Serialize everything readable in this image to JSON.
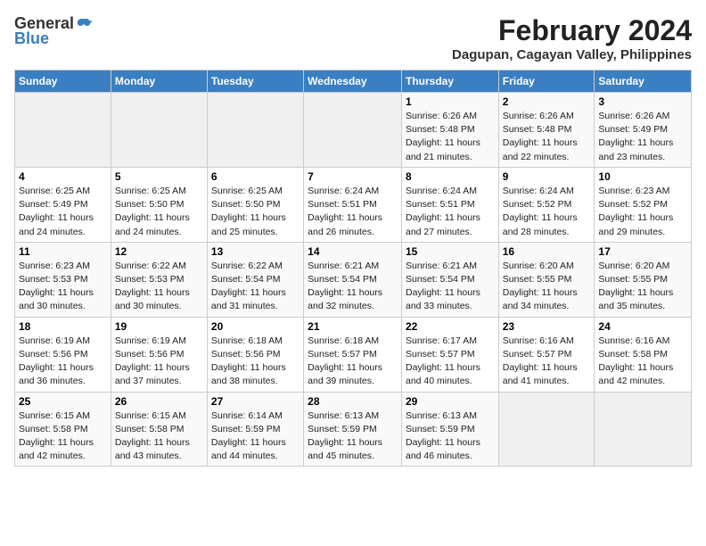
{
  "header": {
    "logo_general": "General",
    "logo_blue": "Blue",
    "month_year": "February 2024",
    "location": "Dagupan, Cagayan Valley, Philippines"
  },
  "days_of_week": [
    "Sunday",
    "Monday",
    "Tuesday",
    "Wednesday",
    "Thursday",
    "Friday",
    "Saturday"
  ],
  "weeks": [
    [
      {
        "day": "",
        "info": ""
      },
      {
        "day": "",
        "info": ""
      },
      {
        "day": "",
        "info": ""
      },
      {
        "day": "",
        "info": ""
      },
      {
        "day": "1",
        "info": "Sunrise: 6:26 AM\nSunset: 5:48 PM\nDaylight: 11 hours and 21 minutes."
      },
      {
        "day": "2",
        "info": "Sunrise: 6:26 AM\nSunset: 5:48 PM\nDaylight: 11 hours and 22 minutes."
      },
      {
        "day": "3",
        "info": "Sunrise: 6:26 AM\nSunset: 5:49 PM\nDaylight: 11 hours and 23 minutes."
      }
    ],
    [
      {
        "day": "4",
        "info": "Sunrise: 6:25 AM\nSunset: 5:49 PM\nDaylight: 11 hours and 24 minutes."
      },
      {
        "day": "5",
        "info": "Sunrise: 6:25 AM\nSunset: 5:50 PM\nDaylight: 11 hours and 24 minutes."
      },
      {
        "day": "6",
        "info": "Sunrise: 6:25 AM\nSunset: 5:50 PM\nDaylight: 11 hours and 25 minutes."
      },
      {
        "day": "7",
        "info": "Sunrise: 6:24 AM\nSunset: 5:51 PM\nDaylight: 11 hours and 26 minutes."
      },
      {
        "day": "8",
        "info": "Sunrise: 6:24 AM\nSunset: 5:51 PM\nDaylight: 11 hours and 27 minutes."
      },
      {
        "day": "9",
        "info": "Sunrise: 6:24 AM\nSunset: 5:52 PM\nDaylight: 11 hours and 28 minutes."
      },
      {
        "day": "10",
        "info": "Sunrise: 6:23 AM\nSunset: 5:52 PM\nDaylight: 11 hours and 29 minutes."
      }
    ],
    [
      {
        "day": "11",
        "info": "Sunrise: 6:23 AM\nSunset: 5:53 PM\nDaylight: 11 hours and 30 minutes."
      },
      {
        "day": "12",
        "info": "Sunrise: 6:22 AM\nSunset: 5:53 PM\nDaylight: 11 hours and 30 minutes."
      },
      {
        "day": "13",
        "info": "Sunrise: 6:22 AM\nSunset: 5:54 PM\nDaylight: 11 hours and 31 minutes."
      },
      {
        "day": "14",
        "info": "Sunrise: 6:21 AM\nSunset: 5:54 PM\nDaylight: 11 hours and 32 minutes."
      },
      {
        "day": "15",
        "info": "Sunrise: 6:21 AM\nSunset: 5:54 PM\nDaylight: 11 hours and 33 minutes."
      },
      {
        "day": "16",
        "info": "Sunrise: 6:20 AM\nSunset: 5:55 PM\nDaylight: 11 hours and 34 minutes."
      },
      {
        "day": "17",
        "info": "Sunrise: 6:20 AM\nSunset: 5:55 PM\nDaylight: 11 hours and 35 minutes."
      }
    ],
    [
      {
        "day": "18",
        "info": "Sunrise: 6:19 AM\nSunset: 5:56 PM\nDaylight: 11 hours and 36 minutes."
      },
      {
        "day": "19",
        "info": "Sunrise: 6:19 AM\nSunset: 5:56 PM\nDaylight: 11 hours and 37 minutes."
      },
      {
        "day": "20",
        "info": "Sunrise: 6:18 AM\nSunset: 5:56 PM\nDaylight: 11 hours and 38 minutes."
      },
      {
        "day": "21",
        "info": "Sunrise: 6:18 AM\nSunset: 5:57 PM\nDaylight: 11 hours and 39 minutes."
      },
      {
        "day": "22",
        "info": "Sunrise: 6:17 AM\nSunset: 5:57 PM\nDaylight: 11 hours and 40 minutes."
      },
      {
        "day": "23",
        "info": "Sunrise: 6:16 AM\nSunset: 5:57 PM\nDaylight: 11 hours and 41 minutes."
      },
      {
        "day": "24",
        "info": "Sunrise: 6:16 AM\nSunset: 5:58 PM\nDaylight: 11 hours and 42 minutes."
      }
    ],
    [
      {
        "day": "25",
        "info": "Sunrise: 6:15 AM\nSunset: 5:58 PM\nDaylight: 11 hours and 42 minutes."
      },
      {
        "day": "26",
        "info": "Sunrise: 6:15 AM\nSunset: 5:58 PM\nDaylight: 11 hours and 43 minutes."
      },
      {
        "day": "27",
        "info": "Sunrise: 6:14 AM\nSunset: 5:59 PM\nDaylight: 11 hours and 44 minutes."
      },
      {
        "day": "28",
        "info": "Sunrise: 6:13 AM\nSunset: 5:59 PM\nDaylight: 11 hours and 45 minutes."
      },
      {
        "day": "29",
        "info": "Sunrise: 6:13 AM\nSunset: 5:59 PM\nDaylight: 11 hours and 46 minutes."
      },
      {
        "day": "",
        "info": ""
      },
      {
        "day": "",
        "info": ""
      }
    ]
  ]
}
